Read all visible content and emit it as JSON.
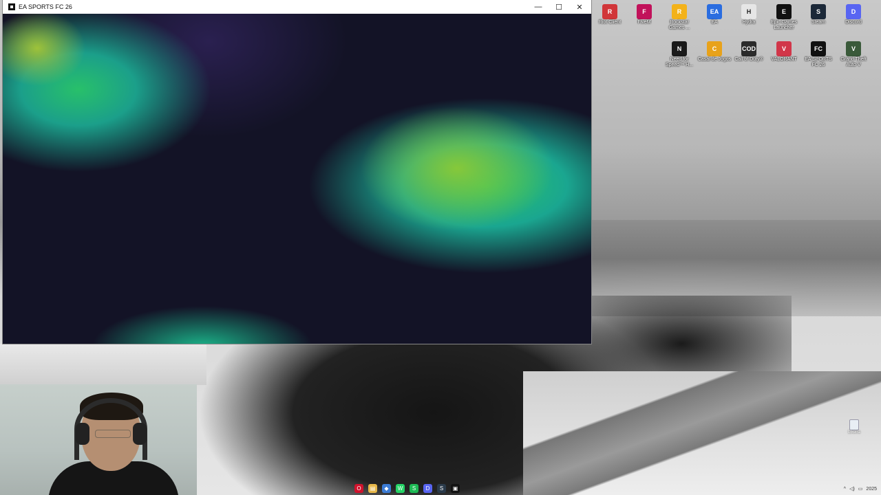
{
  "window": {
    "title": "EA SPORTS FC 26",
    "minimize_glyph": "—",
    "maximize_glyph": "☐",
    "close_glyph": "✕"
  },
  "desktop_icons": [
    {
      "label": "Riot Client",
      "icon": "riot-client-icon",
      "color": "#d13639",
      "glyph": "R"
    },
    {
      "label": "FiveM",
      "icon": "fivem-icon",
      "color": "#c1125a",
      "glyph": "F"
    },
    {
      "label": "Rockstar Games ...",
      "icon": "rockstar-icon",
      "color": "#f3b21a",
      "glyph": "R"
    },
    {
      "label": "EA",
      "icon": "ea-icon",
      "color": "#2a6de0",
      "glyph": "EA"
    },
    {
      "label": "Hydra",
      "icon": "hydra-icon",
      "color": "#e6e6e6",
      "glyph": "H"
    },
    {
      "label": "Epic Games Launcher",
      "icon": "epic-games-icon",
      "color": "#111111",
      "glyph": "E"
    },
    {
      "label": "Steam",
      "icon": "steam-icon",
      "color": "#1b2838",
      "glyph": "S"
    },
    {
      "label": "Discord",
      "icon": "discord-icon",
      "color": "#5865f2",
      "glyph": "D"
    },
    {
      "label": "Need for Speed™ H...",
      "icon": "need-for-speed-icon",
      "color": "#1a1a1a",
      "glyph": "N"
    },
    {
      "label": "Casal de Jogos",
      "icon": "casal-de-jogos-icon",
      "color": "#e8a21a",
      "glyph": "C"
    },
    {
      "label": "Call of Duty®",
      "icon": "call-of-duty-icon",
      "color": "#2b2b2b",
      "glyph": "COD"
    },
    {
      "label": "VALORANT",
      "icon": "valorant-icon",
      "color": "#d13649",
      "glyph": "V"
    },
    {
      "label": "EA SPORTS FC 26",
      "icon": "ea-sports-fc-icon",
      "color": "#111111",
      "glyph": "FC"
    },
    {
      "label": "Grand Theft Auto V",
      "icon": "gta-v-icon",
      "color": "#3a5a3a",
      "glyph": "V"
    }
  ],
  "recycle_bin": {
    "label": "Lixeira",
    "icon": "recycle-bin-icon"
  },
  "taskbar": [
    {
      "name": "opera-icon",
      "color": "#d0122c",
      "glyph": "O"
    },
    {
      "name": "file-explorer-icon",
      "color": "#e8b84a",
      "glyph": "▤"
    },
    {
      "name": "browser-icon",
      "color": "#3b7bd4",
      "glyph": "◆"
    },
    {
      "name": "whatsapp-icon",
      "color": "#25d366",
      "glyph": "W"
    },
    {
      "name": "spotify-icon",
      "color": "#1db954",
      "glyph": "S"
    },
    {
      "name": "discord-taskbar-icon",
      "color": "#5865f2",
      "glyph": "D"
    },
    {
      "name": "steam-taskbar-icon",
      "color": "#2a3a4a",
      "glyph": "S"
    },
    {
      "name": "ea-fc-taskbar-icon",
      "color": "#111111",
      "glyph": "▣"
    }
  ],
  "tray": {
    "chevron": "^",
    "volume": "◁)",
    "network": "▭",
    "clock": "2025"
  }
}
